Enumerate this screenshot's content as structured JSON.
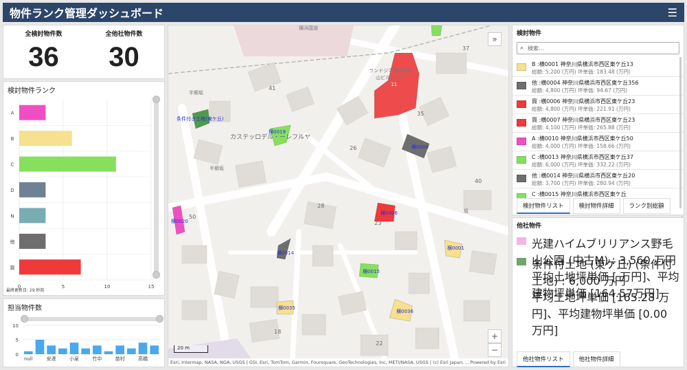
{
  "header": {
    "title": "物件ランク管理ダッシュボード",
    "menu_icon": "hamburger-icon"
  },
  "kpi": {
    "total_label": "全検討物件数",
    "total_value": "36",
    "other_label": "全他社物件数",
    "other_value": "30"
  },
  "rank_panel": {
    "title": "検討物件ランク",
    "updated": "最終更新日: 29 秒前"
  },
  "counts_panel": {
    "title": "担当物件数"
  },
  "chart_data": [
    {
      "type": "bar",
      "orientation": "horizontal",
      "title": "検討物件ランク",
      "categories": [
        "A",
        "B",
        "C",
        "D",
        "N",
        "他",
        "買"
      ],
      "values": [
        3,
        6,
        11,
        3,
        3,
        3,
        7
      ],
      "colors": [
        "#f04fc4",
        "#f5e18e",
        "#86e05e",
        "#6e8294",
        "#78aeb3",
        "#6e6e6e",
        "#ee3a3a"
      ],
      "xlim": [
        0,
        15
      ],
      "xticks": [
        0,
        5,
        10,
        15
      ],
      "grid": true
    },
    {
      "type": "bar",
      "title": "担当物件数",
      "categories": [
        "null",
        "",
        "安達",
        "",
        "小泉",
        "",
        "竹中",
        "",
        "苗村",
        "",
        "高橋",
        ""
      ],
      "values": [
        1,
        5,
        3,
        2,
        4,
        2,
        3,
        1,
        3,
        2,
        4,
        3
      ],
      "color": "#4aa8ec",
      "ylim": [
        0,
        10
      ],
      "yticks": [
        0,
        5,
        10
      ]
    }
  ],
  "map": {
    "numbers": [
      "41",
      "35",
      "37",
      "26",
      "28",
      "23",
      "40",
      "50",
      "18",
      "22"
    ],
    "labels": {
      "building": "カステッロデル・ーレフルヤ",
      "rank_top": "ランドジネ横浜野毛",
      "rank_top2": "山ビルステラ",
      "eleven": "11",
      "property": "条件付き土地(東ケ丘)",
      "street1": "半郷坂",
      "street2": "半郷坂",
      "street3": "坂",
      "top": "横浜国道"
    },
    "markers": [
      "横0019",
      "横0004",
      "横0006",
      "横0001",
      "横0015",
      "横0014",
      "横0035",
      "横0036",
      "横0020"
    ],
    "scale": "20 m",
    "attribution": "Esri, Intermap, NASA, NGA, USGS | GSI, Esri, TomTom, Garmin, Foursquare, GeoTechnologies, Inc, METI/NASA, USGS | (c) Esri Japan, ...",
    "powered": "Powered by Esri",
    "zoom_in": "+",
    "zoom_out": "−",
    "collapse": "»"
  },
  "list1": {
    "title": "検討物件",
    "search_placeholder": "検索...",
    "items": [
      {
        "color": "#f5e18e",
        "line1": "B :横0001 神奈川県横浜市西区東ケ丘13",
        "line2": "総額: 5,200 (万円)  坪単価: 183.48 (万円)"
      },
      {
        "color": "#6e6e6e",
        "line1": "他 :横0004 神奈川県横浜市西区東ケ丘356",
        "line2": "総額: 4,800 (万円)  坪単価: 94.67 (万円)"
      },
      {
        "color": "#ee3a3a",
        "line1": "買 :横0006 神奈川県横浜市西区東ケ丘23",
        "line2": "総額: 4,800 (万円)  坪単価: 221.91 (万円)"
      },
      {
        "color": "#ee3a3a",
        "line1": "買 :横0007 神奈川県横浜市西区東ケ丘23",
        "line2": "総額: 4,100 (万円)  坪単価: 265.88 (万円)"
      },
      {
        "color": "#f04fc4",
        "line1": "A :横0010 神奈川県横浜市西区東ケ丘50",
        "line2": "総額: 4,000 (万円)  坪単価: 158.66 (万円)"
      },
      {
        "color": "#86e05e",
        "line1": "C :横0013 神奈川県横浜市西区東ケ丘37",
        "line2": "総額: 6,000 (万円)  坪単価: 332.22 (万円)"
      },
      {
        "color": "#6e6e6e",
        "line1": "他 :横0014 神奈川県横浜市西区東ケ丘20",
        "line2": "総額: 3,700 (万円)  坪単価: 280.94 (万円)"
      },
      {
        "color": "#86e05e",
        "line1": "C :横0015 神奈川県横浜市西区東ケ丘",
        "line2": ""
      }
    ],
    "tabs": [
      "検討物件リスト",
      "検討物件詳細",
      "ランク別総額"
    ]
  },
  "list2": {
    "title": "他社物件",
    "items": [
      {
        "color": "#f3b5e6",
        "line1": "光建ハイムブリリアンス野毛山公園 (中古M) : 3,560 万円",
        "line2": "平均土地坪単価 [ 万円]、平均建物坪単価 [164.57万円]"
      },
      {
        "color": "#6fa56f",
        "line1": "条件付土地 (東ケ丘) (条件付土地) : 6,000 万円",
        "line2": "平均土地坪単価 [165.28 万円]、平均建物坪単価 [0.00 万円]"
      }
    ],
    "tabs": [
      "他社物件リスト",
      "他社物件詳細"
    ]
  }
}
